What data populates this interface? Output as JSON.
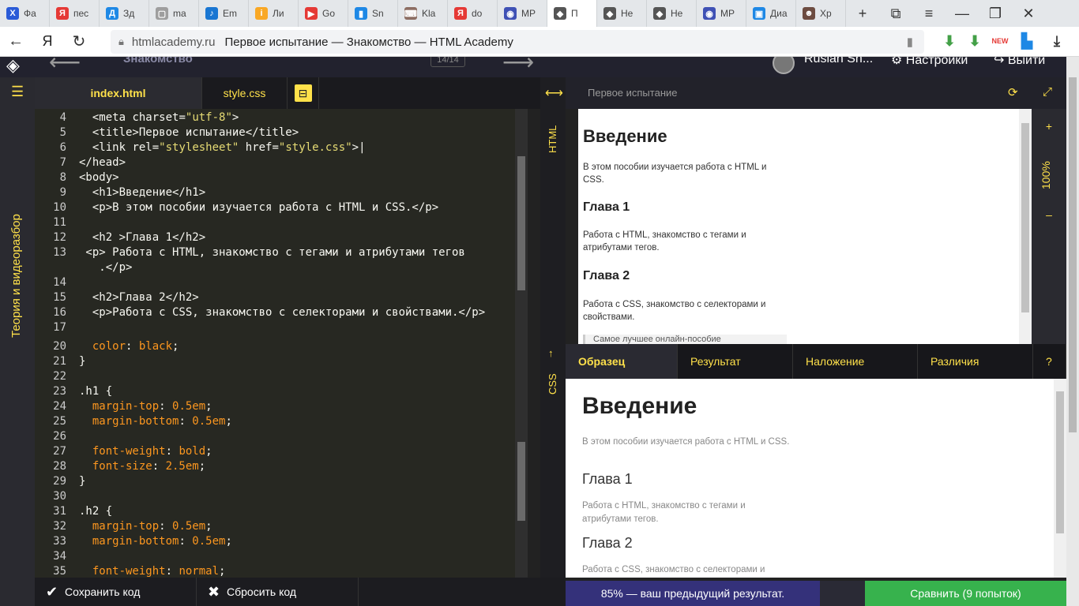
{
  "browser": {
    "tabs": [
      {
        "label": "Фа",
        "icon": "X",
        "color": "#2a5bd7"
      },
      {
        "label": "пес",
        "icon": "Я",
        "color": "#e53935"
      },
      {
        "label": "Зд",
        "icon": "Д",
        "color": "#1e88e5"
      },
      {
        "label": "ma",
        "icon": "▢",
        "color": "#9e9e9e"
      },
      {
        "label": "Em",
        "icon": "♪",
        "color": "#1976d2"
      },
      {
        "label": "Ли",
        "icon": "i",
        "color": "#f9a825"
      },
      {
        "label": "Go",
        "icon": "▶",
        "color": "#e53935"
      },
      {
        "label": "Sn",
        "icon": "▮",
        "color": "#1e88e5"
      },
      {
        "label": "Kla",
        "icon": "⌨",
        "color": "#8d6e63"
      },
      {
        "label": "do",
        "icon": "Я",
        "color": "#e53935"
      },
      {
        "label": "MP",
        "icon": "◉",
        "color": "#3f51b5"
      },
      {
        "label": "П",
        "icon": "◆",
        "color": "#555"
      },
      {
        "label": "Не",
        "icon": "◆",
        "color": "#555"
      },
      {
        "label": "Не",
        "icon": "◆",
        "color": "#555"
      },
      {
        "label": "MP",
        "icon": "◉",
        "color": "#3f51b5"
      },
      {
        "label": "Диа",
        "icon": "▣",
        "color": "#1e88e5"
      },
      {
        "label": "Хр",
        "icon": "☻",
        "color": "#6d4c41"
      }
    ],
    "url_host": "htmlacademy.ru",
    "url_title": "Первое испытание — Знакомство — HTML Academy"
  },
  "app": {
    "section": "Знакомство",
    "counter": "14/14",
    "user": "Ruslan Sh...",
    "settings": "Настройки",
    "logout": "Выйти",
    "sidebar_label": "Теория и видеоразбор"
  },
  "editor": {
    "tab_html": "index.html",
    "tab_css": "style.css",
    "html_lines": [
      {
        "n": "4",
        "segs": [
          [
            "t",
            "  <meta "
          ],
          [
            "a",
            "charset"
          ],
          [
            "t",
            "="
          ],
          [
            "s",
            "\"utf-8\""
          ],
          [
            "t",
            ">"
          ]
        ]
      },
      {
        "n": "5",
        "segs": [
          [
            "t",
            "  <title>Первое испытание</title>"
          ]
        ]
      },
      {
        "n": "6",
        "segs": [
          [
            "t",
            "  <link "
          ],
          [
            "a",
            "rel"
          ],
          [
            "t",
            "="
          ],
          [
            "s",
            "\"stylesheet\""
          ],
          [
            "t",
            " "
          ],
          [
            "a",
            "href"
          ],
          [
            "t",
            "="
          ],
          [
            "s",
            "\"style.css\""
          ],
          [
            "t",
            ">|"
          ]
        ]
      },
      {
        "n": "7",
        "segs": [
          [
            "t",
            "</head>"
          ]
        ]
      },
      {
        "n": "8",
        "segs": [
          [
            "t",
            "<body>"
          ]
        ]
      },
      {
        "n": "9",
        "segs": [
          [
            "t",
            "  <h1>Введение</h1>"
          ]
        ]
      },
      {
        "n": "10",
        "segs": [
          [
            "t",
            "  <p>В этом пособии изучается работа с HTML и CSS.</p>"
          ]
        ]
      },
      {
        "n": "11",
        "segs": [
          [
            "t",
            ""
          ]
        ]
      },
      {
        "n": "12",
        "segs": [
          [
            "t",
            "  <h2 >Глава 1</h2>"
          ]
        ]
      },
      {
        "n": "13",
        "segs": [
          [
            "t",
            " <p> Работа с HTML, знакомство с тегами и атрибутами тегов"
          ]
        ]
      },
      {
        "n": "",
        "segs": [
          [
            "t",
            "   .</p>"
          ]
        ]
      },
      {
        "n": "14",
        "segs": [
          [
            "t",
            ""
          ]
        ]
      },
      {
        "n": "15",
        "segs": [
          [
            "t",
            "  <h2>Глава 2</h2>"
          ]
        ]
      },
      {
        "n": "16",
        "segs": [
          [
            "t",
            "  <p>Работа с CSS, знакомство с селекторами и свойствами.</p>"
          ]
        ]
      },
      {
        "n": "17",
        "segs": [
          [
            "t",
            ""
          ]
        ]
      }
    ],
    "css_lines": [
      {
        "n": "20",
        "segs": [
          [
            "pr",
            "  color"
          ],
          [
            "t",
            ": "
          ],
          [
            "v",
            "black"
          ],
          [
            "t",
            ";"
          ]
        ]
      },
      {
        "n": "21",
        "segs": [
          [
            "t",
            "}"
          ]
        ]
      },
      {
        "n": "22",
        "segs": [
          [
            "t",
            ""
          ]
        ]
      },
      {
        "n": "23",
        "segs": [
          [
            "sel",
            ".h1"
          ],
          [
            "t",
            " {"
          ]
        ]
      },
      {
        "n": "24",
        "segs": [
          [
            "pr",
            "  margin-top"
          ],
          [
            "t",
            ": "
          ],
          [
            "v",
            "0.5em"
          ],
          [
            "t",
            ";"
          ]
        ]
      },
      {
        "n": "25",
        "segs": [
          [
            "pr",
            "  margin-bottom"
          ],
          [
            "t",
            ": "
          ],
          [
            "v",
            "0.5em"
          ],
          [
            "t",
            ";"
          ]
        ]
      },
      {
        "n": "26",
        "segs": [
          [
            "t",
            ""
          ]
        ]
      },
      {
        "n": "27",
        "segs": [
          [
            "pr",
            "  font-weight"
          ],
          [
            "t",
            ": "
          ],
          [
            "v",
            "bold"
          ],
          [
            "t",
            ";"
          ]
        ]
      },
      {
        "n": "28",
        "segs": [
          [
            "pr",
            "  font-size"
          ],
          [
            "t",
            ": "
          ],
          [
            "v",
            "2.5em"
          ],
          [
            "t",
            ";"
          ]
        ]
      },
      {
        "n": "29",
        "segs": [
          [
            "t",
            "}"
          ]
        ]
      },
      {
        "n": "30",
        "segs": [
          [
            "t",
            ""
          ]
        ]
      },
      {
        "n": "31",
        "segs": [
          [
            "sel",
            ".h2"
          ],
          [
            "t",
            " {"
          ]
        ]
      },
      {
        "n": "32",
        "segs": [
          [
            "pr",
            "  margin-top"
          ],
          [
            "t",
            ": "
          ],
          [
            "v",
            "0.5em"
          ],
          [
            "t",
            ";"
          ]
        ]
      },
      {
        "n": "33",
        "segs": [
          [
            "pr",
            "  margin-bottom"
          ],
          [
            "t",
            ": "
          ],
          [
            "v",
            "0.5em"
          ],
          [
            "t",
            ";"
          ]
        ]
      },
      {
        "n": "34",
        "segs": [
          [
            "t",
            ""
          ]
        ]
      },
      {
        "n": "35",
        "segs": [
          [
            "pr",
            "  font-weight"
          ],
          [
            "t",
            ": "
          ],
          [
            "v",
            "normal"
          ],
          [
            "t",
            ";"
          ]
        ]
      }
    ],
    "save_label": "Сохранить код",
    "reset_label": "Сбросить код",
    "label_html": "HTML",
    "label_css": "CSS"
  },
  "preview": {
    "title": "Первое испытание",
    "zoom": "100%",
    "zoom_in": "+",
    "zoom_out": "–",
    "h1": "Введение",
    "p1": "В этом пособии изучается работа с HTML и CSS.",
    "h2a": "Глава 1",
    "p2": "Работа с HTML, знакомство с тегами и атрибутами тегов.",
    "h2b": "Глава 2",
    "p3": "Работа с CSS, знакомство с селекторами и свойствами.",
    "snippet": "Самое лучшее онлайн-пособие"
  },
  "compare": {
    "tabs": [
      "Образец",
      "Результат",
      "Наложение",
      "Различия"
    ],
    "help": "?",
    "h1": "Введение",
    "p1": "В этом пособии изучается работа с HTML и CSS.",
    "h2a": "Глава 1",
    "p2": "Работа с HTML, знакомство с тегами и атрибутами тегов.",
    "h2b": "Глава 2",
    "p3": "Работа с CSS, знакомство с селекторами и свойствами.",
    "prev_result": "85% — ваш предыдущий результат.",
    "compare_btn": "Сравнить (9 попыток)"
  }
}
